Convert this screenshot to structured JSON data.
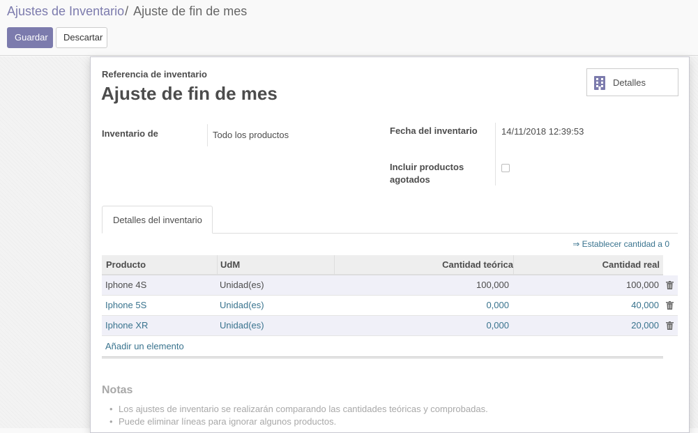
{
  "breadcrumb": {
    "parent": "Ajustes de Inventario",
    "separator": "/",
    "current": "Ajuste de fin de mes"
  },
  "buttons": {
    "save": "Guardar",
    "discard": "Descartar"
  },
  "form": {
    "reference_label": "Referencia de inventario",
    "title": "Ajuste de fin de mes",
    "details_button": "Detalles",
    "inventory_of_label": "Inventario de",
    "inventory_of_value": "Todo los productos",
    "date_label": "Fecha del inventario",
    "date_value": "14/11/2018 12:39:53",
    "include_exhausted_label_1": "Incluir productos",
    "include_exhausted_label_2": "agotados",
    "include_exhausted_checked": false
  },
  "tabs": [
    {
      "label": "Detalles del inventario",
      "active": true
    }
  ],
  "set_zero_link": "⇒ Establecer cantidad a 0",
  "table": {
    "columns": [
      "Producto",
      "UdM",
      "Cantidad teórica",
      "Cantidad real"
    ],
    "rows": [
      {
        "product": "Iphone 4S",
        "uom": "Unidad(es)",
        "theoretical": "100,000",
        "real": "100,000"
      },
      {
        "product": "Iphone 5S",
        "uom": "Unidad(es)",
        "theoretical": "0,000",
        "real": "40,000"
      },
      {
        "product": "Iphone XR",
        "uom": "Unidad(es)",
        "theoretical": "0,000",
        "real": "20,000"
      }
    ],
    "add_line": "Añadir un elemento"
  },
  "notes": {
    "title": "Notas",
    "items": [
      "Los ajustes de inventario se realizarán comparando las cantidades teóricas y comprobadas.",
      "Puede eliminar líneas para ignorar algunos productos."
    ]
  },
  "colors": {
    "primary": "#7c7bad",
    "link": "#39738e",
    "text": "#4c4c4c",
    "muted": "#a8a8a8"
  }
}
